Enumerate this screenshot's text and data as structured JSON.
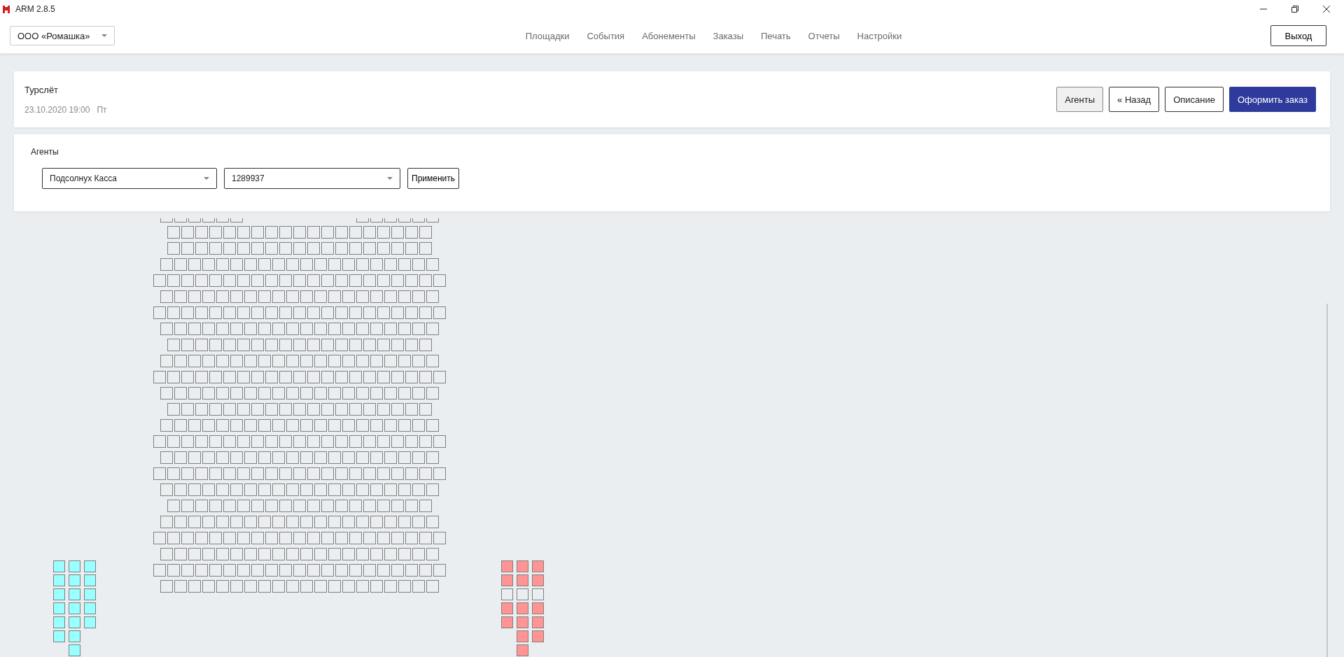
{
  "window": {
    "title": "ARM 2.8.5"
  },
  "header": {
    "organization": "ООО «Ромашка»",
    "nav": [
      "Площадки",
      "События",
      "Абонементы",
      "Заказы",
      "Печать",
      "Отчеты",
      "Настройки"
    ],
    "exit_button": "Выход"
  },
  "event": {
    "title": "Турслёт",
    "date": "23.10.2020 19:00",
    "weekday": "Пт",
    "buttons": [
      {
        "label": "Агенты",
        "kind": "toggle",
        "selected": true
      },
      {
        "label": "«  Назад",
        "kind": "plain",
        "selected": false
      },
      {
        "label": "Описание",
        "kind": "plain",
        "selected": false
      },
      {
        "label": "Оформить заказ",
        "kind": "primary",
        "selected": false
      }
    ]
  },
  "agents": {
    "title": "Агенты",
    "agent": "Подсолнух Касса",
    "code": "1289937",
    "apply_button": "Применить"
  },
  "seat_map": {
    "rows": [
      {
        "kind": "split"
      },
      {
        "kind": "narrow"
      },
      {
        "kind": "narrow"
      },
      {
        "kind": "medium"
      },
      {
        "kind": "wide"
      },
      {
        "kind": "medium"
      },
      {
        "kind": "wide"
      },
      {
        "kind": "medium"
      },
      {
        "kind": "narrow"
      },
      {
        "kind": "medium"
      },
      {
        "kind": "wide"
      },
      {
        "kind": "medium"
      },
      {
        "kind": "narrow"
      },
      {
        "kind": "medium"
      },
      {
        "kind": "wide"
      },
      {
        "kind": "medium"
      },
      {
        "kind": "wide"
      },
      {
        "kind": "medium"
      },
      {
        "kind": "narrow"
      },
      {
        "kind": "medium"
      },
      {
        "kind": "wide"
      },
      {
        "kind": "medium"
      },
      {
        "kind": "wide"
      },
      {
        "kind": "medium"
      }
    ],
    "left_block": {
      "columns": [
        {
          "seats": [
            {
              "color": "#99ffff"
            },
            {
              "color": "#99ffff"
            },
            {
              "color": "#99ffff"
            },
            {
              "color": "#99ffff"
            },
            {
              "color": "#99ffff"
            },
            {
              "color": "#99ffff"
            }
          ]
        },
        {
          "seats": [
            {
              "color": "#99ffff"
            },
            {
              "color": "#99ffff"
            },
            {
              "color": "#99ffff"
            },
            {
              "color": "#99ffff"
            },
            {
              "color": "#99ffff"
            },
            {
              "color": "#99ffff"
            },
            {
              "color": "#99ffff"
            }
          ]
        },
        {
          "seats": [
            {
              "color": "#99ffff"
            },
            {
              "color": "#99ffff"
            },
            {
              "color": "#99ffff"
            },
            {
              "color": "#99ffff"
            },
            {
              "color": "#99ffff"
            }
          ]
        }
      ]
    },
    "right_block": {
      "columns": [
        {
          "seats": [
            {
              "color": "#ff9494"
            },
            {
              "color": "#ff9494"
            },
            {
              "color": "#ebeef1"
            },
            {
              "color": "#ff9494"
            },
            {
              "color": "#ff9494"
            }
          ]
        },
        {
          "seats": [
            {
              "color": "#ff9494"
            },
            {
              "color": "#ff9494"
            },
            {
              "color": "#ebeef1"
            },
            {
              "color": "#ff9494"
            },
            {
              "color": "#ff9494"
            },
            {
              "color": "#ff9494"
            },
            {
              "color": "#ff9494"
            }
          ]
        },
        {
          "seats": [
            {
              "color": "#ff9494"
            },
            {
              "color": "#ff9494"
            },
            {
              "color": "#ebeef1"
            },
            {
              "color": "#ff9494"
            },
            {
              "color": "#ff9494"
            },
            {
              "color": "#ff9494"
            }
          ]
        }
      ]
    }
  }
}
